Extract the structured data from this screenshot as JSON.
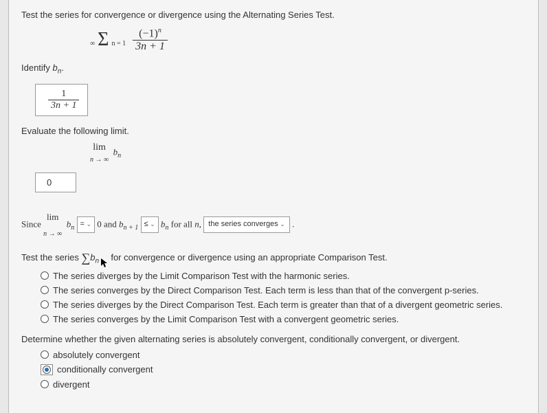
{
  "q1": {
    "prompt": "Test the series for convergence or divergence using the Alternating Series Test.",
    "sigma_top": "∞",
    "sigma_bot": "n = 1",
    "frac_num": "(−1)",
    "frac_num_sup": "n",
    "frac_den": "3n + 1"
  },
  "identify": {
    "prompt_prefix": "Identify ",
    "bn": "b",
    "bn_sub": "n",
    "prompt_suffix": ".",
    "ans_num": "1",
    "ans_den": "3n + 1"
  },
  "limit": {
    "prompt": "Evaluate the following limit.",
    "lim": "lim",
    "limsub": "n → ∞",
    "b": "b",
    "bsub": "n",
    "answer": "0"
  },
  "since": {
    "prefix": "Since ",
    "lim": "lim",
    "limsub": "n → ∞",
    "b1": "b",
    "b1sub": "n",
    "sel1": "=",
    "mid1": " 0 and ",
    "b2": "b",
    "b2sub": "n + 1",
    "sel2": "≤",
    "b3": "b",
    "b3sub": "n",
    "mid2": " for all ",
    "n": "n",
    "comma": ", ",
    "sel3": "the series converges",
    "period": "."
  },
  "comparison": {
    "prompt_pre": "Test the series ",
    "sigma": "∑",
    "b": "b",
    "bsub": "n",
    "prompt_post": " for convergence or divergence using an appropriate Comparison Test.",
    "opts": [
      "The series diverges by the Limit Comparison Test with the harmonic series.",
      "The series converges by the Direct Comparison Test. Each term is less than that of the convergent p-series.",
      "The series diverges by the Direct Comparison Test. Each term is greater than that of a divergent geometric series.",
      "The series converges by the Limit Comparison Test with a convergent geometric series."
    ]
  },
  "absolute": {
    "prompt": "Determine whether the given alternating series is absolutely convergent, conditionally convergent, or divergent.",
    "opts": [
      "absolutely convergent",
      "conditionally convergent",
      "divergent"
    ],
    "selected": 1
  }
}
